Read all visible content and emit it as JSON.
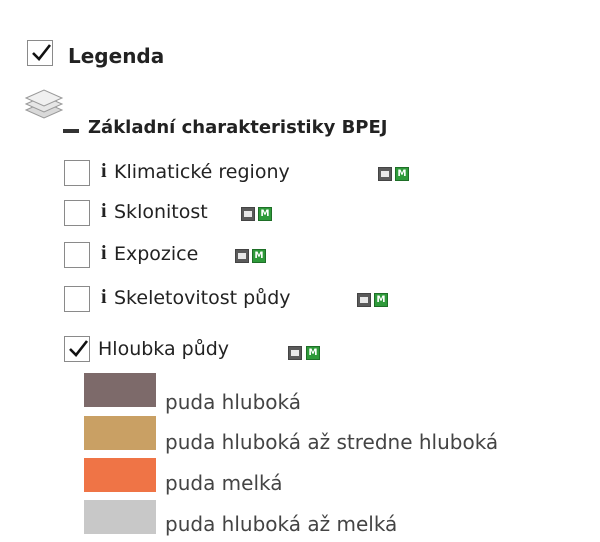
{
  "legend": {
    "label": "Legenda",
    "checked": true
  },
  "group": {
    "label": "Základní charakteristiky BPEJ",
    "icon": "layers-icon",
    "collapse_icon": "collapse-icon"
  },
  "layers": [
    {
      "info": "i",
      "label": "Klimatické regiony",
      "checked": false,
      "m": "M"
    },
    {
      "info": "i",
      "label": "Sklonitost",
      "checked": false,
      "m": "M"
    },
    {
      "info": "i",
      "label": "Expozice",
      "checked": false,
      "m": "M"
    },
    {
      "info": "i",
      "label": "Skeletovitost půdy",
      "checked": false,
      "m": "M"
    },
    {
      "info": "",
      "label": "Hloubka půdy",
      "checked": true,
      "m": "M"
    }
  ],
  "classes": [
    {
      "label": "puda hluboká",
      "color": "#7d6a6a"
    },
    {
      "label": "puda hluboká až stredne hluboká",
      "color": "#c9a064"
    },
    {
      "label": "puda melká",
      "color": "#ef7446"
    },
    {
      "label": "puda hluboká až melká",
      "color": "#c8c8c8"
    }
  ]
}
